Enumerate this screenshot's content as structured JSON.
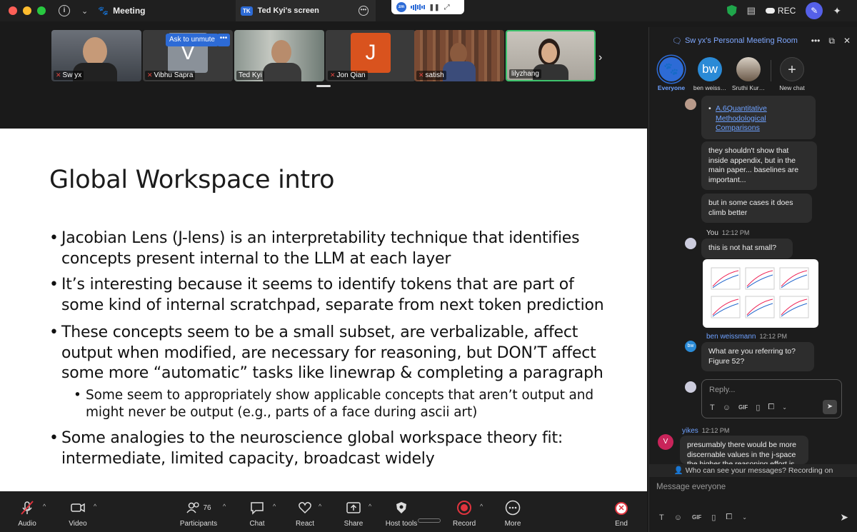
{
  "titlebar": {
    "meeting_label": "Meeting",
    "screen_tab_badge": "TK",
    "screen_tab_label": "Ted Kyi's screen",
    "zm_logo": "zm",
    "rec_label": "REC"
  },
  "gallery": {
    "ask_to_unmute": "Ask to unmute",
    "tiles": [
      {
        "name": "Sw yx",
        "bg": "#5a5f66"
      },
      {
        "name": "Vibhu Sapra",
        "letter": "V",
        "bg": "#3a3a3a",
        "letter_bg": "#8a9199",
        "letter_color": "#ffffff"
      },
      {
        "name": "Ted Kyi",
        "bg": "#6e7f7a"
      },
      {
        "name": "Jon Qian",
        "letter": "J",
        "bg": "#3a3a3a",
        "letter_bg": "#d9531e",
        "letter_color": "#ffffff"
      },
      {
        "name": "satish",
        "bg": "#6b4a3a"
      },
      {
        "name": "lilyzhang",
        "bg": "#b7b2aa"
      }
    ]
  },
  "slide": {
    "title": "Global Workspace intro",
    "bullets": [
      "Jacobian Lens (J-lens) is an interpretability technique that identifies concepts present internal to the LLM at each layer",
      "It’s interesting because it seems to identify tokens that are part of some kind of internal scratchpad, separate from next token prediction",
      "These concepts seem to be a small subset, are verbalizable, affect output when modified, are necessary for reasoning, but DON’T affect some more “automatic” tasks like linewrap & completing a paragraph",
      "Some seem to appropriately show applicable concepts that aren’t output and might never be output (e.g., parts of a face during ascii art)",
      "Some analogies to the neuroscience global workspace theory fit: intermediate, limited capacity, broadcast widely"
    ]
  },
  "chat": {
    "room_title": "Sw yx's Personal Meeting Room",
    "tabs": [
      {
        "label": "Everyone",
        "icon": "paw-icon",
        "initials": ""
      },
      {
        "label": "ben weiss…",
        "icon": "",
        "initials": "bw"
      },
      {
        "label": "Sruthi Kur…",
        "icon": "",
        "initials": ""
      },
      {
        "label": "New chat",
        "icon": "plus-icon",
        "initials": "+"
      }
    ],
    "link_text": "A.6Quantitative Methodological Comparisons",
    "msg_appendix": "they shouldn't show that inside appendix, but in the main paper... baselines are important...",
    "msg_climb": "but in some cases it does climb better",
    "you_name": "You",
    "you_time": "12:12 PM",
    "you_msg": "this is not hat small?",
    "ben_name": "ben weissmann",
    "ben_time": "12:12 PM",
    "ben_initials": "bw",
    "ben_msg": "What are you referring to? Figure 52?",
    "reply_placeholder": "Reply...",
    "gif_label": "GIF",
    "yikes_name": "yikes",
    "yikes_time": "12:12 PM",
    "yikes_initial": "V",
    "yikes_msg": "presumably there would be more discernable values in the j-space the higher the reasoning effort is",
    "visibility_note": "Who can see your messages? Recording on",
    "message_placeholder": "Message everyone"
  },
  "toolbar": {
    "audio": "Audio",
    "video": "Video",
    "participants": "Participants",
    "participants_count": "76",
    "chat": "Chat",
    "react": "React",
    "share": "Share",
    "host_tools": "Host tools",
    "record": "Record",
    "more": "More",
    "end": "End"
  },
  "colors": {
    "accent": "#2d6bd6",
    "end_red": "#e0343e",
    "link_blue": "#6ea1ff",
    "chat_bg": "#1c1c1c"
  }
}
